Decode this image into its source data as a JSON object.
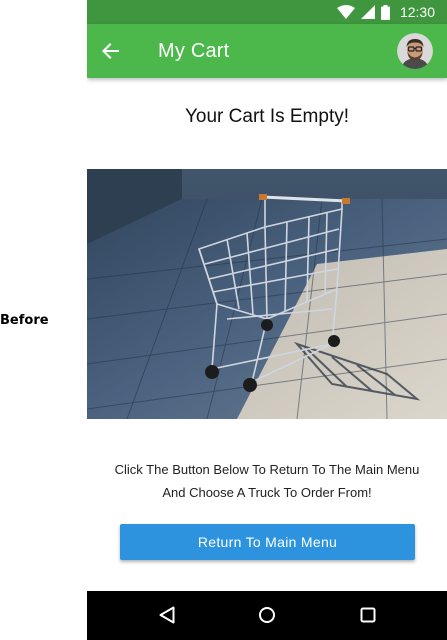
{
  "side_label": "Before",
  "status_bar": {
    "time": "12:30",
    "icons": [
      "wifi-icon",
      "cellular-signal-icon",
      "battery-icon"
    ]
  },
  "app_bar": {
    "title": "My Cart",
    "back_icon": "arrow-back-icon",
    "avatar": "user-avatar",
    "color": "#4cb84c",
    "status_color": "#3f963f"
  },
  "content": {
    "heading": "Your Cart Is Empty!",
    "image": "empty-shopping-cart-photo",
    "message_line1": "Click The Button Below To Return To The Main Menu",
    "message_line2": "And Choose A Truck To Order From!",
    "button_label": "Return To Main Menu",
    "button_color": "#2d93de"
  },
  "nav_bar": {
    "icons": [
      "back-triangle-icon",
      "home-circle-icon",
      "recents-square-icon"
    ]
  }
}
